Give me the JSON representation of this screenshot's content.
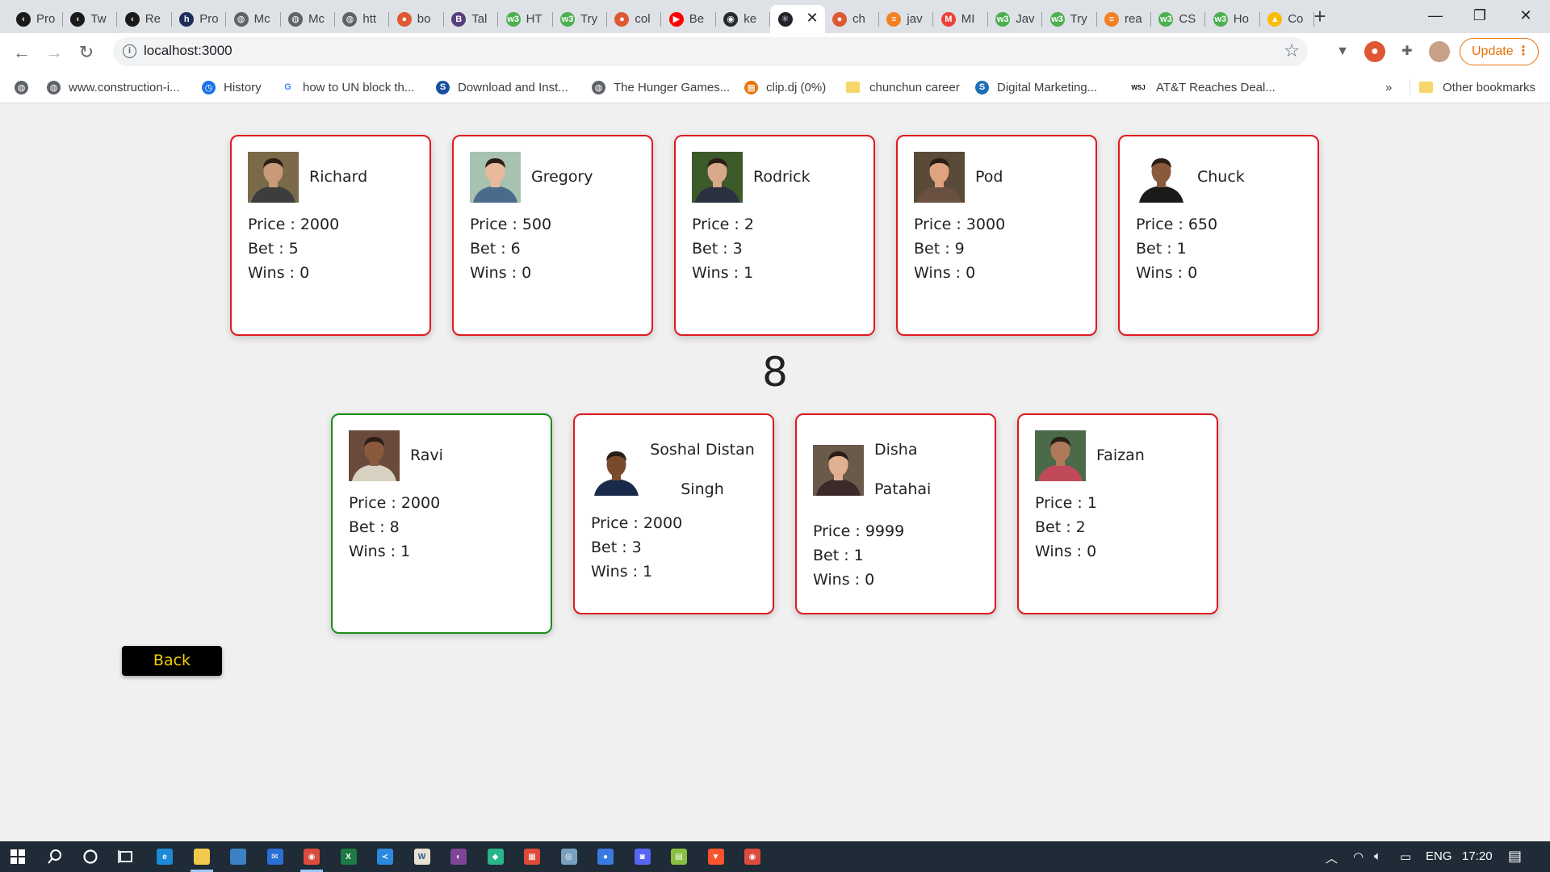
{
  "tabs": [
    {
      "label": "Pro",
      "color": "#1a1a1a",
      "glyph": "‹"
    },
    {
      "label": "Tw",
      "color": "#1a1a1a",
      "glyph": "‹"
    },
    {
      "label": "Re",
      "color": "#1a1a1a",
      "glyph": "‹"
    },
    {
      "label": "Pro",
      "color": "#1d2d5c",
      "glyph": "h"
    },
    {
      "label": "Mc",
      "color": "#5f6368",
      "glyph": "◍"
    },
    {
      "label": "Mc",
      "color": "#5f6368",
      "glyph": "◍"
    },
    {
      "label": "htt",
      "color": "#5f6368",
      "glyph": "◍"
    },
    {
      "label": "bo",
      "color": "#de5833",
      "glyph": "●"
    },
    {
      "label": "Tal",
      "color": "#563d7c",
      "glyph": "B"
    },
    {
      "label": "HT",
      "color": "#4caf50",
      "glyph": "w3"
    },
    {
      "label": "Try",
      "color": "#4caf50",
      "glyph": "w3"
    },
    {
      "label": "col",
      "color": "#de5833",
      "glyph": "●"
    },
    {
      "label": "Be",
      "color": "#ff0000",
      "glyph": "▶"
    },
    {
      "label": "ke",
      "color": "#24292e",
      "glyph": "◉"
    },
    {
      "label": "",
      "color": "#20232a",
      "glyph": "⚛"
    },
    {
      "label": "ch",
      "color": "#de5833",
      "glyph": "●"
    },
    {
      "label": "jav",
      "color": "#f48024",
      "glyph": "≡"
    },
    {
      "label": "MI",
      "color": "#ea4335",
      "glyph": "M"
    },
    {
      "label": "Jav",
      "color": "#4caf50",
      "glyph": "w3"
    },
    {
      "label": "Try",
      "color": "#4caf50",
      "glyph": "w3"
    },
    {
      "label": "rea",
      "color": "#f48024",
      "glyph": "≡"
    },
    {
      "label": "CS",
      "color": "#4caf50",
      "glyph": "w3"
    },
    {
      "label": "Ho",
      "color": "#4caf50",
      "glyph": "w3"
    },
    {
      "label": "Co",
      "color": "#fbbc04",
      "glyph": "▲"
    }
  ],
  "active_tab_index": 14,
  "address": "localhost:3000",
  "update_label": "Update",
  "bookmarks": [
    {
      "label": "",
      "type": "globe"
    },
    {
      "label": "www.construction-i...",
      "type": "globe"
    },
    {
      "label": "History",
      "type": "history"
    },
    {
      "label": "how to UN block th...",
      "type": "google"
    },
    {
      "label": "Download and Inst...",
      "type": "s"
    },
    {
      "label": "The Hunger Games...",
      "type": "globe"
    },
    {
      "label": "clip.dj (0%)",
      "type": "clip"
    },
    {
      "label": "chunchun career",
      "type": "folder"
    },
    {
      "label": "Digital Marketing...",
      "type": "ds"
    },
    {
      "label": "AT&T Reaches Deal...",
      "type": "wsj"
    }
  ],
  "bookmarks_more": "»",
  "other_bookmarks": "Other bookmarks",
  "players_top": [
    {
      "name": "Richard",
      "price": "Price : 2000",
      "bet": "Bet : 5",
      "wins": "Wins : 0",
      "skin": "#c99a7a",
      "bg": "#7a6a4a",
      "shirt": "#3d3d3d"
    },
    {
      "name": "Gregory",
      "price": "Price : 500",
      "bet": "Bet : 6",
      "wins": "Wins : 0",
      "skin": "#e8b99a",
      "bg": "#a8c2b0",
      "shirt": "#4a6c8c"
    },
    {
      "name": "Rodrick",
      "price": "Price : 2",
      "bet": "Bet : 3",
      "wins": "Wins : 1",
      "skin": "#d7a88a",
      "bg": "#3d5a2a",
      "shirt": "#2a3040"
    },
    {
      "name": "Pod",
      "price": "Price : 3000",
      "bet": "Bet : 9",
      "wins": "Wins : 0",
      "skin": "#e0a380",
      "bg": "#5a4a3a",
      "shirt": "#6a5040"
    },
    {
      "name": "Chuck",
      "price": "Price : 650",
      "bet": "Bet : 1",
      "wins": "Wins : 0",
      "skin": "#8a5a3c",
      "bg": "#ffffff",
      "shirt": "#1a1a1a"
    }
  ],
  "result_number": "8",
  "players_bottom": [
    {
      "name": "Ravi",
      "price": "Price : 2000",
      "bet": "Bet : 8",
      "wins": "Wins : 1",
      "skin": "#8a5a3c",
      "bg": "#6a4a3a",
      "shirt": "#d8d0c0",
      "winner": true
    },
    {
      "name": "Soshal Distan Singh",
      "price": "Price : 2000",
      "bet": "Bet : 3",
      "wins": "Wins : 1",
      "skin": "#7a4a2c",
      "bg": "#ffffff",
      "shirt": "#1a2a4a",
      "winner": false
    },
    {
      "name": "Disha Patahai",
      "price": "Price : 9999",
      "bet": "Bet : 1",
      "wins": "Wins : 0",
      "skin": "#e0b090",
      "bg": "#6a5a4a",
      "shirt": "#3a2a2a",
      "winner": false
    },
    {
      "name": "Faizan",
      "price": "Price : 1",
      "bet": "Bet : 2",
      "wins": "Wins : 0",
      "skin": "#b07a5a",
      "bg": "#4a6a4a",
      "shirt": "#c04a5a",
      "winner": false
    }
  ],
  "back_label": "Back",
  "taskbar": {
    "apps": [
      {
        "name": "edge",
        "color": "#1c8ad6",
        "glyph": "e"
      },
      {
        "name": "explorer",
        "color": "#f2c94c",
        "glyph": ""
      },
      {
        "name": "store",
        "color": "#3b82c4",
        "glyph": ""
      },
      {
        "name": "mail",
        "color": "#2a6fd6",
        "glyph": "✉"
      },
      {
        "name": "chrome",
        "color": "#dd4b3e",
        "glyph": "◉"
      },
      {
        "name": "excel",
        "color": "#1e7a45",
        "glyph": "X"
      },
      {
        "name": "vscode",
        "color": "#2b8ae0",
        "glyph": "≺"
      },
      {
        "name": "word",
        "color": "#e8e0d0",
        "glyph": "W"
      },
      {
        "name": "tor",
        "color": "#7d4698",
        "glyph": "◐"
      },
      {
        "name": "app",
        "color": "#28b58a",
        "glyph": "◆"
      },
      {
        "name": "app",
        "color": "#e04a3a",
        "glyph": "▦"
      },
      {
        "name": "app",
        "color": "#7aa0c0",
        "glyph": "◎"
      },
      {
        "name": "app",
        "color": "#3a7ae0",
        "glyph": "●"
      },
      {
        "name": "discord",
        "color": "#5865f2",
        "glyph": "◙"
      },
      {
        "name": "notepad",
        "color": "#8ac040",
        "glyph": "▤"
      },
      {
        "name": "brave",
        "color": "#fb542b",
        "glyph": "▼"
      },
      {
        "name": "chrome",
        "color": "#dd4b3e",
        "glyph": "◉"
      }
    ],
    "language": "ENG",
    "time": "17:20"
  }
}
